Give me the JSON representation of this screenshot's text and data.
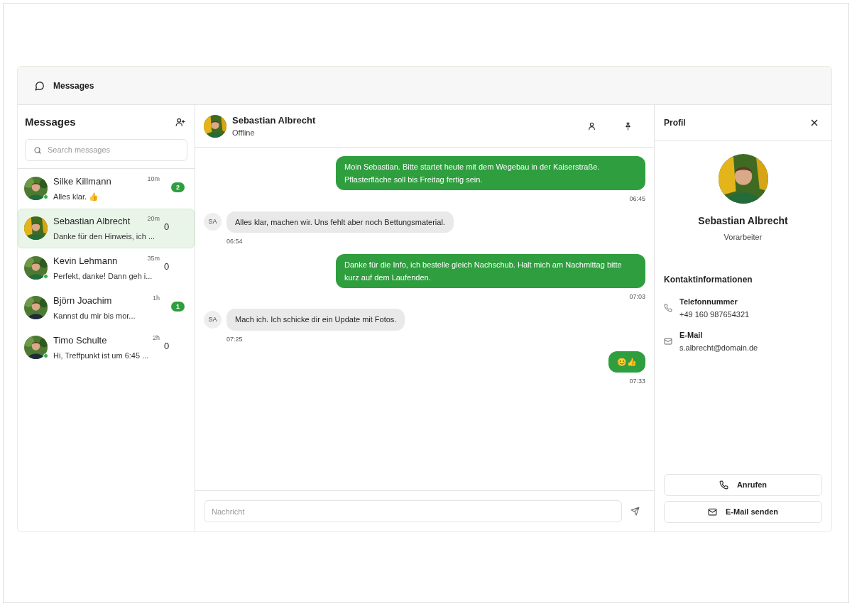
{
  "app_bar": {
    "title": "Messages"
  },
  "sidebar": {
    "title": "Messages",
    "search": {
      "placeholder": "Search messages"
    },
    "conversations": [
      {
        "name": "Silke Killmann",
        "time": "10m",
        "preview": "Alles klar. 👍",
        "unread": "2",
        "badge": true,
        "online": true,
        "selected": false
      },
      {
        "name": "Sebastian Albrecht",
        "time": "20m",
        "preview": "Danke für den Hinweis, ich ...",
        "unread": "0",
        "badge": false,
        "online": false,
        "selected": true
      },
      {
        "name": "Kevin Lehmann",
        "time": "35m",
        "preview": "Perfekt, danke! Dann geh i...",
        "unread": "0",
        "badge": false,
        "online": true,
        "selected": false
      },
      {
        "name": "Björn Joachim",
        "time": "1h",
        "preview": "Kannst du mir bis mor...",
        "unread": "1",
        "badge": true,
        "online": false,
        "selected": false
      },
      {
        "name": "Timo Schulte",
        "time": "2h",
        "preview": "Hi, Treffpunkt ist um 6:45 ...",
        "unread": "0",
        "badge": false,
        "online": true,
        "selected": false
      }
    ]
  },
  "chat": {
    "name": "Sebastian Albrecht",
    "status": "Offline",
    "messages": [
      {
        "kind": "outgoing",
        "text": "Moin Sebastian. Bitte startet heute mit dem Wegebau in der Kaiserstraße. Pflasterfläche soll bis Freitag fertig sein.",
        "time": "06:45"
      },
      {
        "kind": "incoming",
        "initials": "SA",
        "text": "Alles klar, machen wir. Uns fehlt aber noch Bettungsmaterial.",
        "time": "06:54"
      },
      {
        "kind": "outgoing",
        "text": "Danke für die Info, ich bestelle gleich Nachschub. Halt mich am Nachmittag bitte kurz auf dem Laufenden.",
        "time": "07:03"
      },
      {
        "kind": "incoming",
        "initials": "SA",
        "text": "Mach ich. Ich schicke dir ein Update mit Fotos.",
        "time": "07:25"
      },
      {
        "kind": "outgoing",
        "text": "😊👍",
        "time": "07:33"
      }
    ],
    "composer": {
      "placeholder": "Nachricht"
    }
  },
  "profile": {
    "title": "Profil",
    "name": "Sebastian Albrecht",
    "role": "Vorarbeiter",
    "section_title": "Kontaktinformationen",
    "contacts": [
      {
        "kind": "phone",
        "label": "Telefonnummer",
        "value": "+49 160 987654321"
      },
      {
        "kind": "email",
        "label": "E-Mail",
        "value": "s.albrecht@domain.de"
      }
    ],
    "actions": [
      {
        "kind": "phone",
        "label": "Anrufen"
      },
      {
        "kind": "email",
        "label": "E-Mail senden"
      }
    ]
  }
}
